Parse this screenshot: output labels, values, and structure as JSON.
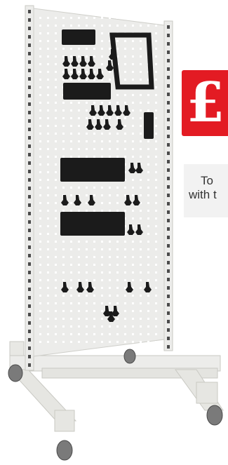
{
  "product_image": {
    "description_icon": "perforated-tool-panel-trolley",
    "colors": {
      "frame": "#e8e8e4",
      "frame_shadow": "#c9c9c3",
      "panel": "#ececea",
      "holes": "#ffffff",
      "tools": "#1b1b1b",
      "wheels": "#7a7a7a"
    }
  },
  "price_badge": {
    "symbol": "£",
    "color": "#e31b23"
  },
  "promo": {
    "line1": "To",
    "line2": "with t"
  }
}
